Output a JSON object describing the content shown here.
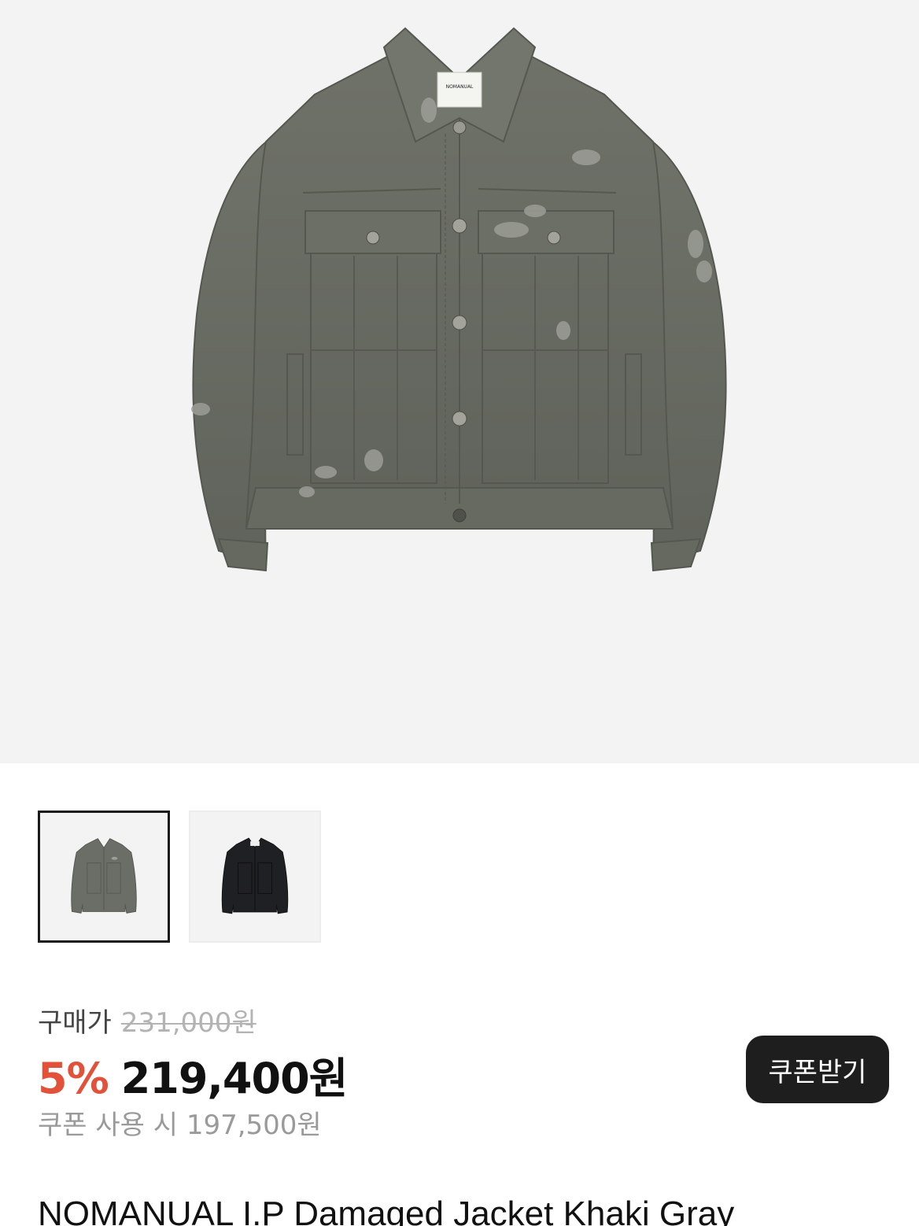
{
  "gallery": {
    "main_image_icon": "jacket-khaki-gray-image",
    "label_text": "NOMANUAL",
    "thumbnails": [
      {
        "icon": "jacket-khaki-gray-thumbnail",
        "selected": true
      },
      {
        "icon": "jacket-black-thumbnail",
        "selected": false
      }
    ]
  },
  "price": {
    "label": "구매가",
    "original": "231,000원",
    "discount": "5%",
    "sale": "219,400원",
    "coupon_price": "쿠폰 사용 시 197,500원"
  },
  "coupon_button": {
    "label": "쿠폰받기"
  },
  "product": {
    "title": "NOMANUAL I.P Damaged Jacket Khaki Gray"
  },
  "colors": {
    "discount": "#e2513a",
    "button_bg": "#1e1e1e",
    "image_bg": "#f3f3f3",
    "jacket_khaki": "#6b6e66",
    "jacket_black": "#1f2024"
  }
}
